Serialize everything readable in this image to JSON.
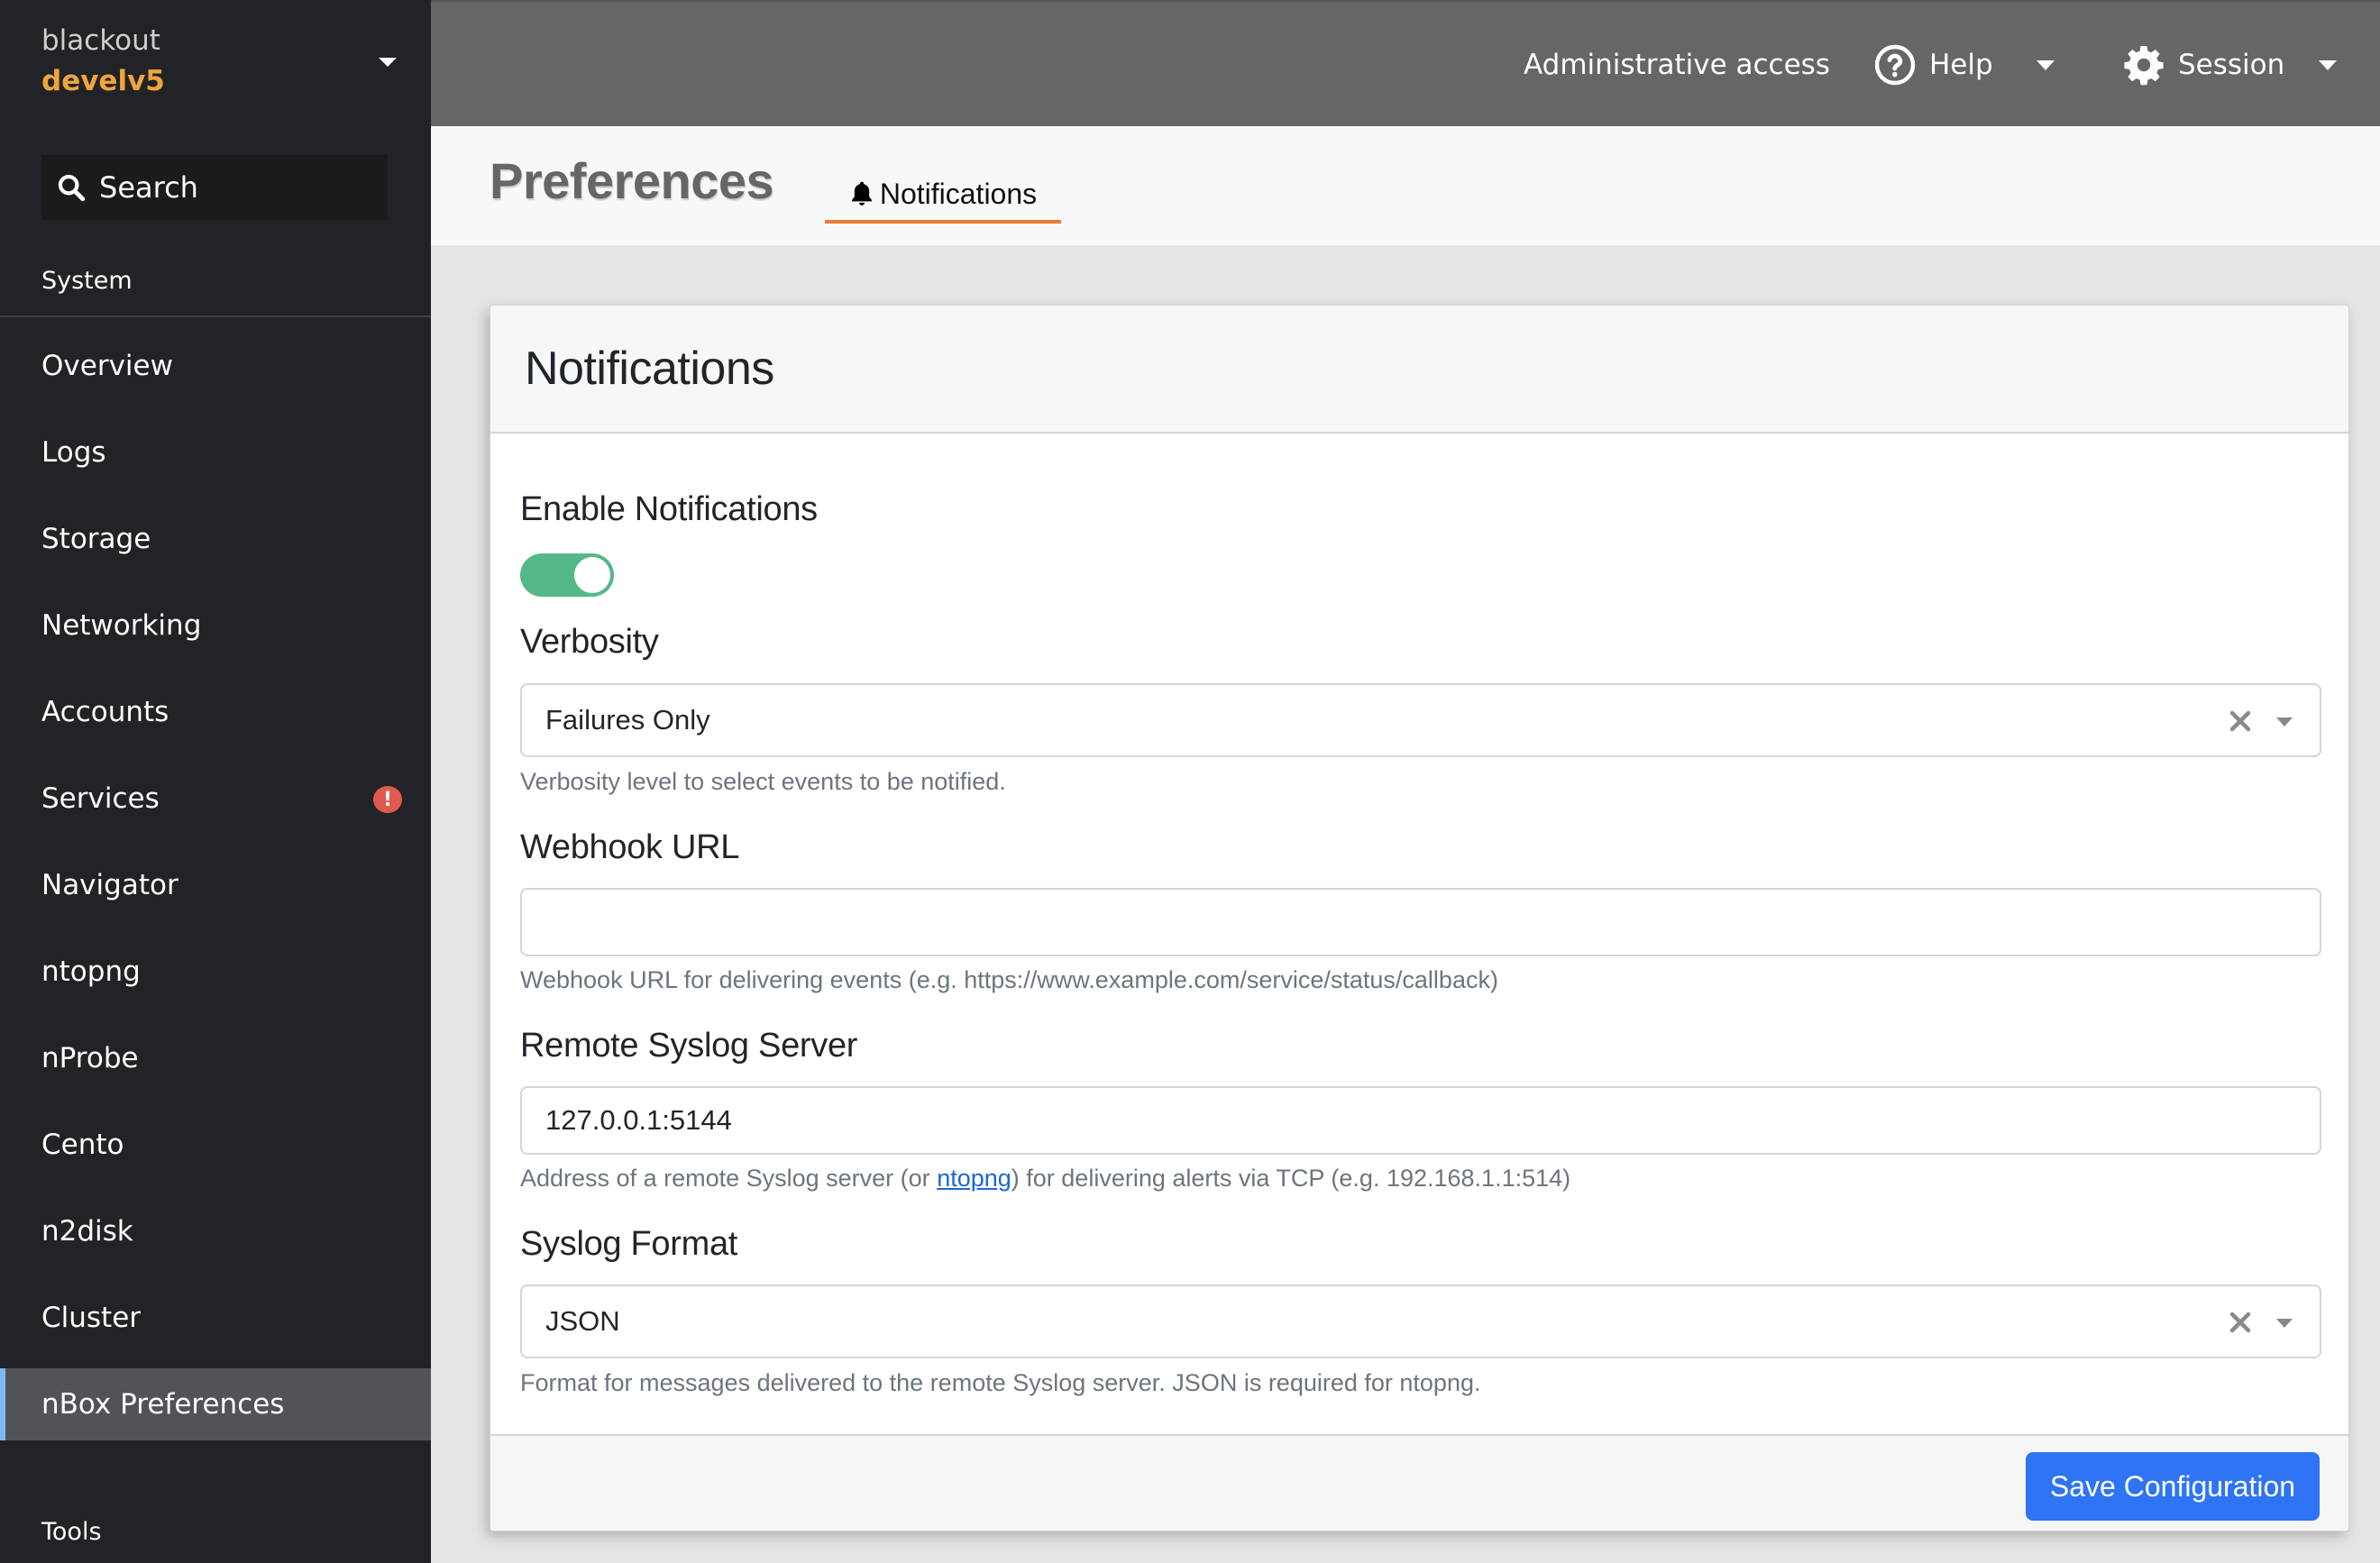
{
  "sidebar": {
    "host_name": "blackout",
    "host_sub": "develv5",
    "search_label": "Search",
    "section_system": "System",
    "section_tools": "Tools",
    "items": [
      {
        "label": "Overview"
      },
      {
        "label": "Logs"
      },
      {
        "label": "Storage"
      },
      {
        "label": "Networking"
      },
      {
        "label": "Accounts"
      },
      {
        "label": "Services",
        "badge": "!"
      },
      {
        "label": "Navigator"
      },
      {
        "label": "ntopng"
      },
      {
        "label": "nProbe"
      },
      {
        "label": "Cento"
      },
      {
        "label": "n2disk"
      },
      {
        "label": "Cluster"
      },
      {
        "label": "nBox Preferences",
        "active": true
      }
    ]
  },
  "topbar": {
    "admin_access": "Administrative access",
    "help": "Help",
    "session": "Session"
  },
  "page": {
    "title": "Preferences",
    "tabs": [
      {
        "label": "Notifications",
        "icon": "bell-icon",
        "active": true
      }
    ]
  },
  "card": {
    "title": "Notifications",
    "fields": {
      "enable": {
        "label": "Enable Notifications",
        "value": true
      },
      "verbosity": {
        "label": "Verbosity",
        "value": "Failures Only",
        "help": "Verbosity level to select events to be notified."
      },
      "webhook": {
        "label": "Webhook URL",
        "value": "",
        "help": "Webhook URL for delivering events (e.g. https://www.example.com/service/status/callback)"
      },
      "syslog_server": {
        "label": "Remote Syslog Server",
        "value": "127.0.0.1:5144",
        "help_before": "Address of a remote Syslog server (or ",
        "help_link": "ntopng",
        "help_after": ") for delivering alerts via TCP (e.g. 192.168.1.1:514)"
      },
      "syslog_format": {
        "label": "Syslog Format",
        "value": "JSON",
        "help": "Format for messages delivered to the remote Syslog server. JSON is required for ntopng."
      }
    },
    "save_label": "Save Configuration"
  },
  "colors": {
    "accent_orange": "#ee7a30",
    "host_orange": "#f0a43a",
    "toggle_green": "#55b888",
    "primary_blue": "#2e74f5",
    "badge_red": "#e05a4e"
  }
}
